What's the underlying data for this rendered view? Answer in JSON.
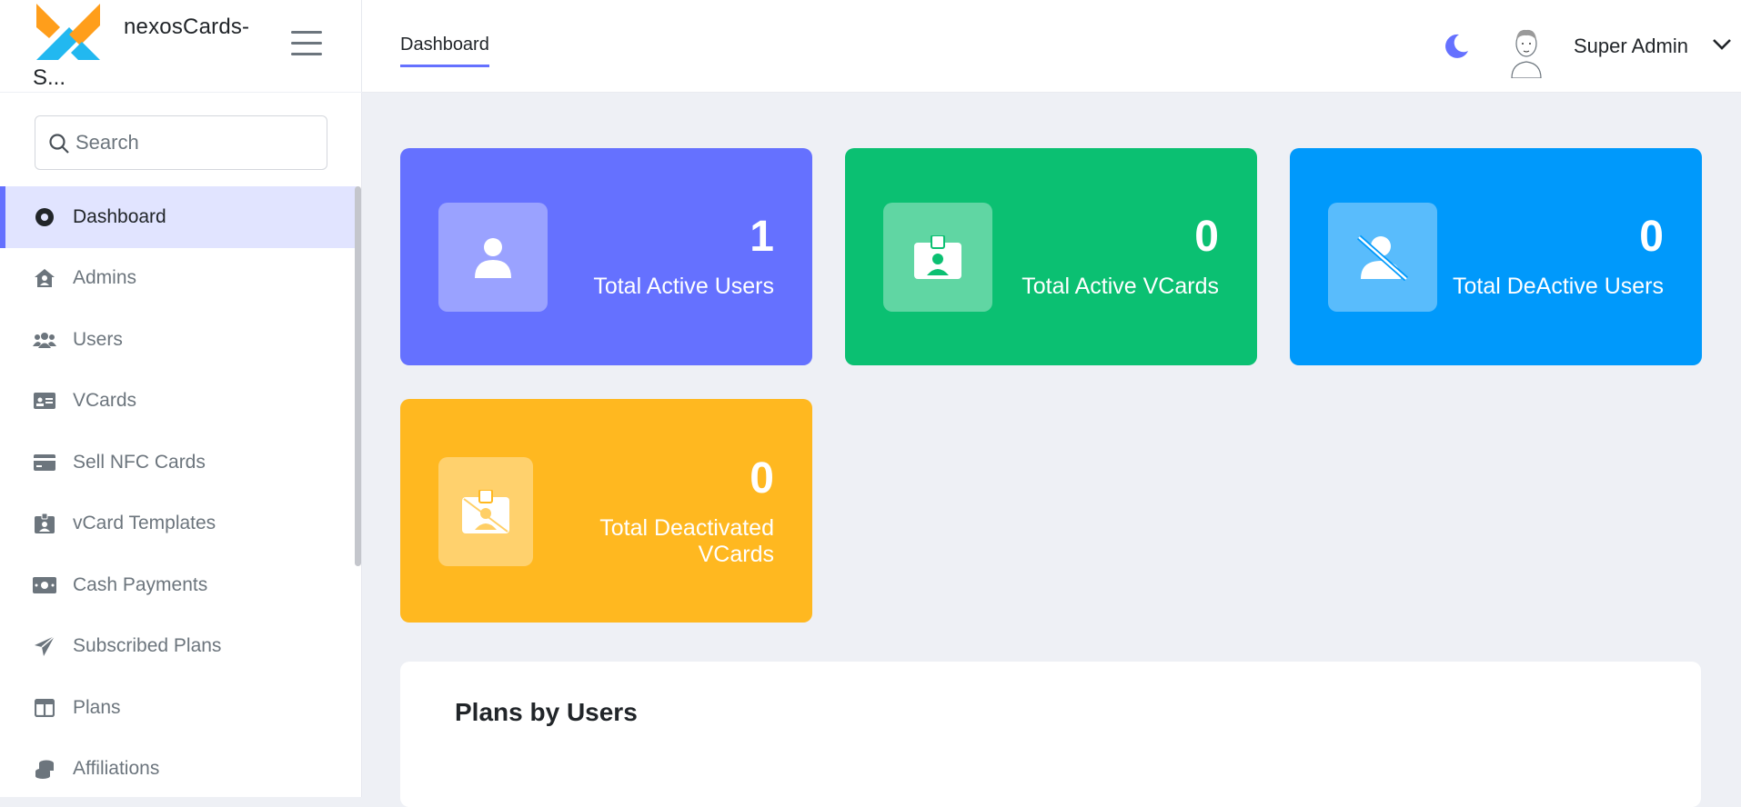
{
  "brand": {
    "name_line1": "nexosCards-",
    "name_line2": "S..."
  },
  "search": {
    "placeholder": "Search"
  },
  "sidebar": {
    "items": [
      {
        "label": "Dashboard",
        "icon": "dashboard-dot-icon",
        "active": true
      },
      {
        "label": "Admins",
        "icon": "user-shield-icon"
      },
      {
        "label": "Users",
        "icon": "users-icon"
      },
      {
        "label": "VCards",
        "icon": "id-card-icon"
      },
      {
        "label": "Sell NFC Cards",
        "icon": "credit-card-icon"
      },
      {
        "label": "vCard Templates",
        "icon": "id-badge-icon"
      },
      {
        "label": "Cash Payments",
        "icon": "money-bill-icon"
      },
      {
        "label": "Subscribed Plans",
        "icon": "paper-plane-icon"
      },
      {
        "label": "Plans",
        "icon": "table-columns-icon"
      },
      {
        "label": "Affiliations",
        "icon": "coins-icon"
      }
    ]
  },
  "header": {
    "tab": "Dashboard",
    "user_name": "Super Admin"
  },
  "cards": [
    {
      "value": "1",
      "label": "Total Active Users",
      "icon": "user-icon",
      "color": "#6571ff"
    },
    {
      "value": "0",
      "label": "Total Active VCards",
      "icon": "id-badge-icon",
      "color": "#0bc072"
    },
    {
      "value": "0",
      "label": "Total DeActive Users",
      "icon": "user-slash-icon",
      "color": "#0099fb"
    },
    {
      "value": "0",
      "label": "Total Deactivated VCards",
      "icon": "id-badge-slash-icon",
      "color": "#ffb820"
    }
  ],
  "panel": {
    "title": "Plans by Users"
  },
  "colors": {
    "accent": "#6571ff",
    "active_bg": "#e1e4ff"
  }
}
